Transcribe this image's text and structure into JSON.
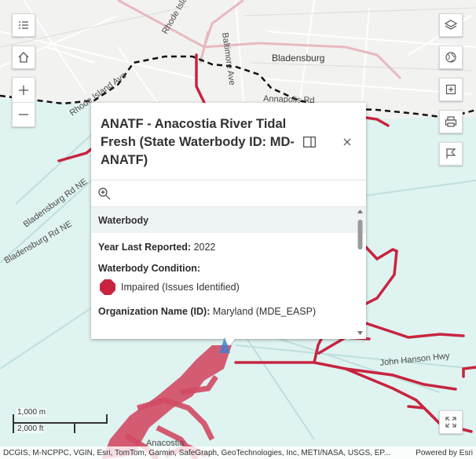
{
  "map": {
    "places": [
      {
        "name": "Bladensburg"
      },
      {
        "name": "Anacostia"
      }
    ],
    "roads": [
      {
        "name": "Rhode Island Ave"
      },
      {
        "name": "Rhode Island Ave"
      },
      {
        "name": "Baltimore Ave"
      },
      {
        "name": "Annapolis Rd"
      },
      {
        "name": "Bladensburg Rd NE"
      },
      {
        "name": "Bladensburg Rd NE"
      },
      {
        "name": "John Hanson Hwy"
      }
    ],
    "colors": {
      "water": "#dff3f1",
      "land": "#f2f2f0",
      "impaired_line": "#c8243f",
      "highway": "#e8b9bf",
      "boundary": "#000000"
    }
  },
  "toolbar_left": {
    "legend_icon": "legend-list-icon",
    "home_icon": "home-icon",
    "zoom_in_icon": "plus-icon",
    "zoom_out_icon": "minus-icon"
  },
  "toolbar_right": {
    "layers_icon": "layers-icon",
    "basemap_icon": "globe-icon",
    "expand_icon": "expand-icon",
    "print_icon": "printer-icon",
    "bookmark_icon": "bookmark-icon",
    "fullscreen_icon": "fullscreen-icon"
  },
  "popup": {
    "title": "ANATF - Anacostia River Tidal Fresh (State Waterbody ID: MD-ANATF)",
    "section": "Waterbody",
    "year_label": "Year Last Reported:",
    "year_value": "2022",
    "condition_label": "Waterbody Condition:",
    "condition_value": "Impaired (Issues Identified)",
    "org_label": "Organization Name (ID):",
    "org_value": "Maryland (MDE_EASP)",
    "status_color": "#c8243f"
  },
  "scalebar": {
    "metric": "1,000 m",
    "imperial": "2,000 ft"
  },
  "attribution": {
    "sources": "DCGIS, M-NCPPC, VGIN, Esri, TomTom, Garmin, SafeGraph, GeoTechnologies, Inc, METI/NASA, USGS, EP...",
    "powered": "Powered by Esri"
  }
}
